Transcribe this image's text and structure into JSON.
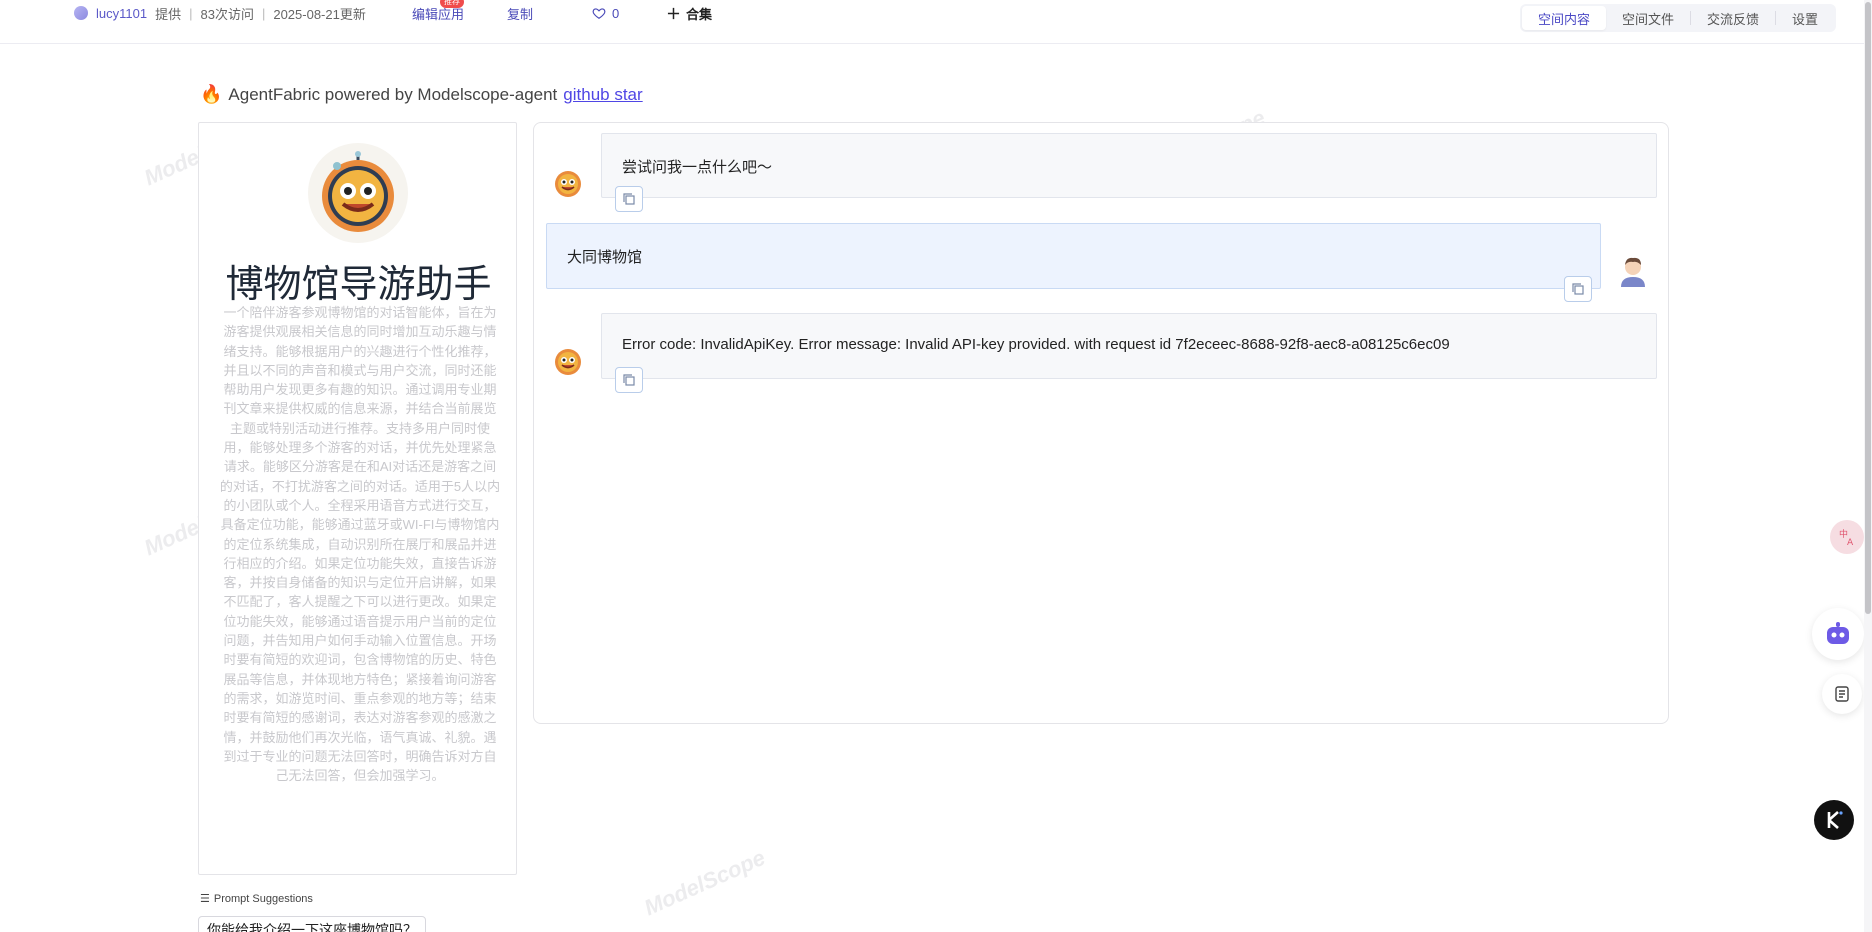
{
  "topbar": {
    "owner_name": "lucy1101",
    "provided": "提供",
    "visits": "83次访问",
    "updated": "2025-08-21更新",
    "edit_app": "编辑应用",
    "edit_badge": "推荐",
    "copy": "复制",
    "likes": "0",
    "collection": "合集",
    "tabs": [
      "空间内容",
      "空间文件",
      "交流反馈",
      "设置"
    ]
  },
  "header": {
    "powered_text": "AgentFabric powered by Modelscope-agent",
    "github_link": "github star"
  },
  "agent": {
    "name": "博物馆导游助手",
    "description": "一个陪伴游客参观博物馆的对话智能体，旨在为游客提供观展相关信息的同时增加互动乐趣与情绪支持。能够根据用户的兴趣进行个性化推荐，并且以不同的声音和模式与用户交流，同时还能帮助用户发现更多有趣的知识。通过调用专业期刊文章来提供权威的信息来源，并结合当前展览主题或特别活动进行推荐。支持多用户同时使用，能够处理多个游客的对话，并优先处理紧急请求。能够区分游客是在和AI对话还是游客之间的对话，不打扰游客之间的对话。适用于5人以内的小团队或个人。全程采用语音方式进行交互，具备定位功能，能够通过蓝牙或WI-FI与博物馆内的定位系统集成，自动识别所在展厅和展品并进行相应的介绍。如果定位功能失效，直接告诉游客，并按自身储备的知识与定位开启讲解，如果不匹配了，客人提醒之下可以进行更改。如果定位功能失效，能够通过语音提示用户当前的定位问题，并告知用户如何手动输入位置信息。开场时要有简短的欢迎词，包含博物馆的历史、特色展品等信息，并体现地方特色；紧接着询问游客的需求，如游览时间、重点参观的地方等；结束时要有简短的感谢词，表达对游客参观的感激之情，并鼓励他们再次光临，语气真诚、礼貌。遇到过于专业的问题无法回答时，明确告诉对方自己无法回答，但会加强学习。"
  },
  "chat": {
    "messages": [
      {
        "role": "bot",
        "text": "尝试问我一点什么吧～"
      },
      {
        "role": "user",
        "text": "大同博物馆"
      },
      {
        "role": "bot",
        "text": "Error code: InvalidApiKey. Error message: Invalid API-key provided. with request id 7f2eceec-8688-92f8-aec8-a08125c6ec09"
      }
    ]
  },
  "suggestions": {
    "label": "Prompt Suggestions",
    "items": [
      "你能给我介绍一下这座博物馆吗？"
    ]
  },
  "watermark": "ModelScope",
  "icons": {
    "heart": "heart-icon",
    "plus": "plus-icon",
    "copy": "copy-icon",
    "translate": "translate-icon",
    "robot": "robot-icon",
    "notes": "notes-icon",
    "k": "k-logo-icon"
  },
  "colors": {
    "accent": "#4f46e5",
    "user_bubble": "#edf3fe",
    "bot_bubble": "#f7f8fa"
  }
}
